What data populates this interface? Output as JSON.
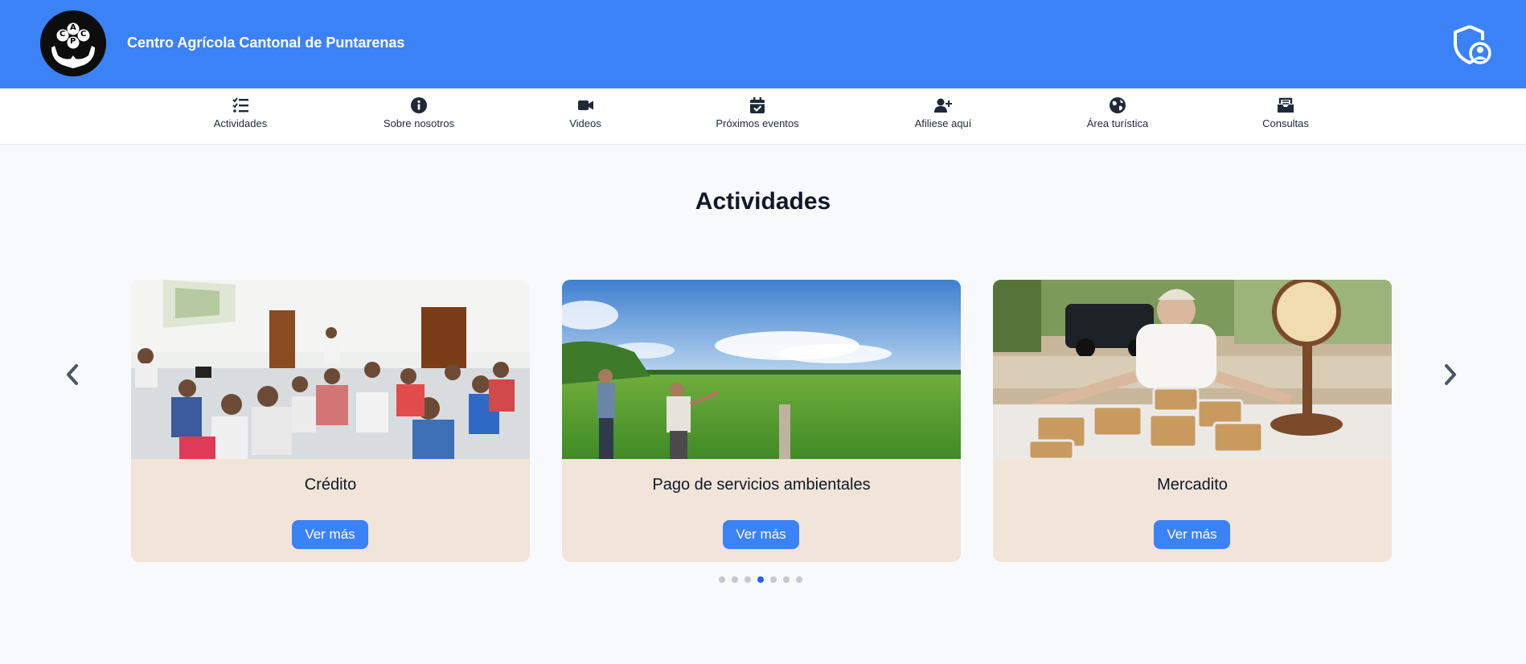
{
  "header": {
    "logo_letters": [
      "C",
      "A",
      "C",
      "P"
    ],
    "title": "Centro Agrícola Cantonal de Puntarenas",
    "admin_icon": "shield-user-icon",
    "bg_color": "#3b82f6"
  },
  "nav": {
    "items": [
      {
        "label": "Actividades",
        "icon": "list-check-icon"
      },
      {
        "label": "Sobre nosotros",
        "icon": "info-circle-icon"
      },
      {
        "label": "Videos",
        "icon": "video-camera-icon"
      },
      {
        "label": "Próximos eventos",
        "icon": "calendar-check-icon"
      },
      {
        "label": "Afiliese aquí",
        "icon": "user-plus-icon"
      },
      {
        "label": "Área turística",
        "icon": "globe-icon"
      },
      {
        "label": "Consultas",
        "icon": "inbox-envelope-icon"
      }
    ]
  },
  "section": {
    "title": "Actividades"
  },
  "carousel": {
    "prev_icon": "chevron-left-icon",
    "next_icon": "chevron-right-icon",
    "cards": [
      {
        "title": "Crédito",
        "button": "Ver más"
      },
      {
        "title": "Pago de servicios ambientales",
        "button": "Ver más"
      },
      {
        "title": "Mercadito",
        "button": "Ver más"
      }
    ],
    "dot_count": 7,
    "active_dot": 4
  },
  "colors": {
    "accent": "#3b82f6",
    "card_bg": "#f1e4d8",
    "active_dot": "#2563eb"
  }
}
